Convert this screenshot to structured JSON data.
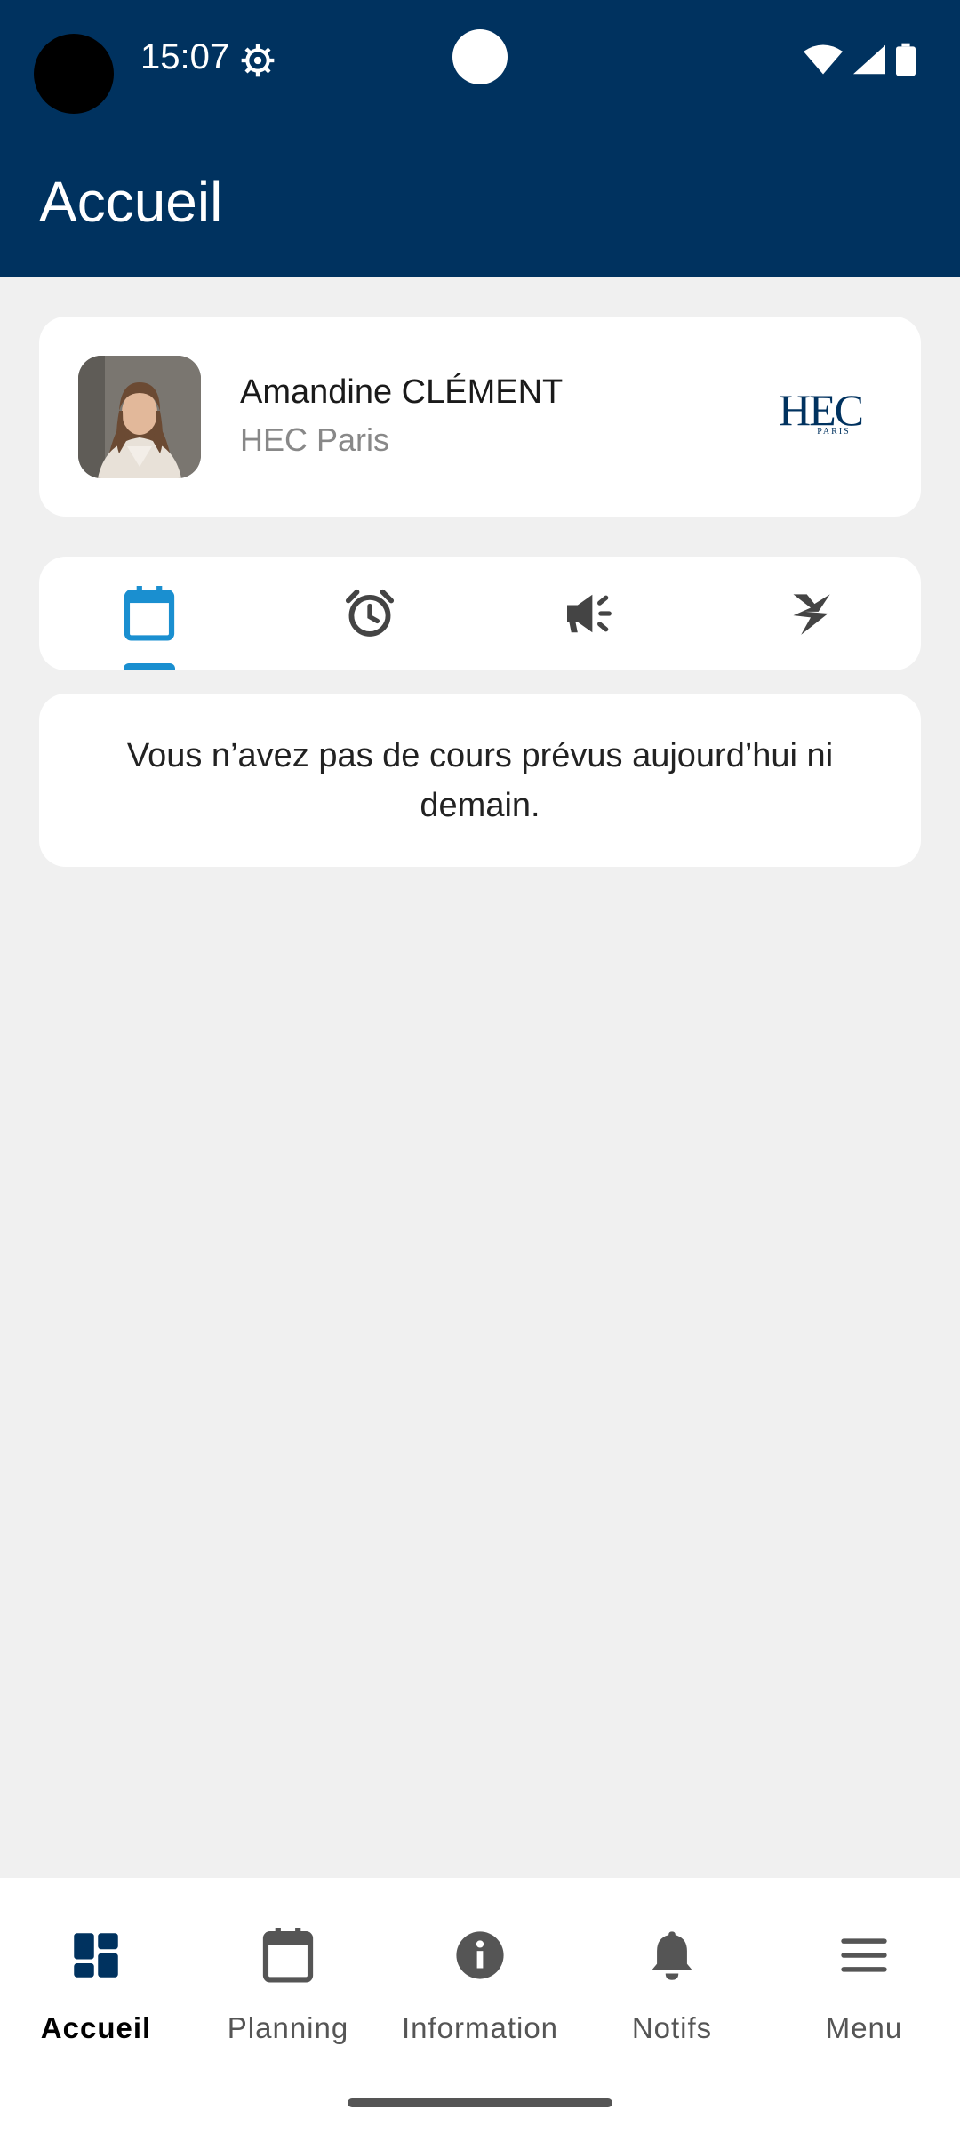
{
  "status_bar": {
    "time": "15:07"
  },
  "header": {
    "title": "Accueil"
  },
  "profile": {
    "name": "Amandine CLÉMENT",
    "school": "HEC Paris",
    "logo_text": "HEC",
    "logo_subtext": "PARIS"
  },
  "tabs": [
    {
      "icon": "calendar-icon",
      "active": true
    },
    {
      "icon": "alarm-clock-icon",
      "active": false
    },
    {
      "icon": "megaphone-icon",
      "active": false
    },
    {
      "icon": "flash-icon",
      "active": false
    }
  ],
  "message": {
    "text": "Vous n’avez pas de cours prévus aujourd’hui ni demain."
  },
  "bottom_nav": [
    {
      "label": "Accueil",
      "icon": "dashboard-icon",
      "active": true
    },
    {
      "label": "Planning",
      "icon": "calendar-icon",
      "active": false
    },
    {
      "label": "Information",
      "icon": "info-icon",
      "active": false
    },
    {
      "label": "Notifs",
      "icon": "bell-icon",
      "active": false
    },
    {
      "label": "Menu",
      "icon": "menu-icon",
      "active": false
    }
  ],
  "colors": {
    "header_bg": "#00325f",
    "accent": "#1a8fd0",
    "background": "#f0f0f0"
  }
}
